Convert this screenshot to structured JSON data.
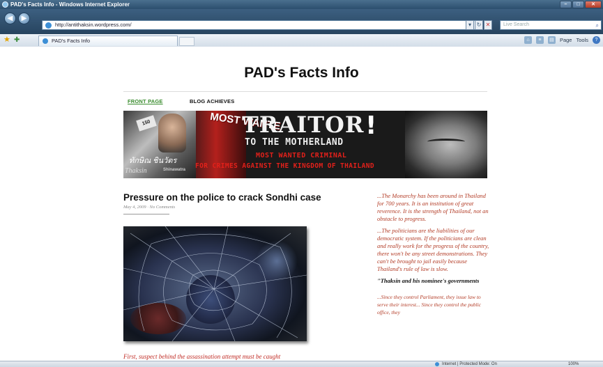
{
  "browser": {
    "window_title": "PAD's Facts Info - Windows Internet Explorer",
    "address": "http://antithaksin.wordpress.com/",
    "search_placeholder": "Live Search",
    "tab_title": "PAD's Facts Info",
    "command_bar": {
      "page": "Page",
      "tools": "Tools"
    },
    "status": {
      "zone": "Internet | Protected Mode: On",
      "zoom": "100%"
    }
  },
  "site": {
    "title": "PAD's Facts Info",
    "nav": {
      "front_page": "FRONT PAGE",
      "blog_archives": "BLOG ACHIEVES"
    }
  },
  "banner": {
    "traitor": "TRAITOR",
    "exclamation": "!",
    "to_the_motherland": "TO THE MOTHERLAND",
    "most_wanted_criminal": "MOST WANTED CRIMINAL",
    "for_crimes": "FOR CRIMES AGAINST THE KINGDOM OF THAILAND",
    "most_wanted_sign": "MOST WANTE",
    "thai_name": "ทักษิณ ชินวัตร",
    "latin_name": "Thaksin",
    "surname": "Shinawatra",
    "newspaper_tag": "150"
  },
  "post": {
    "title": "Pressure on the police to crack Sondhi case",
    "meta": "May 4, 2009 · No Comments",
    "excerpt": "First, suspect behind the assassination attempt must be caught"
  },
  "sidebar": {
    "p1": "...The Monarchy has been around in Thailand for 700 years. It is an institution of great reverence. It is the strength of Thailand, not an obstacle to progress.",
    "p2": "...The politicians are the liabilities of our democratic system. If the politicians are clean and really work for the progress of the country, there won't be any street demonstrations. They can't be brought to jail easily because Thailand's rule of law is slow.",
    "heading": "\"Thaksin and his nominee's governments",
    "p3": "...Since they control Parliament, they issue law to serve their interest... Since they control the public office, they"
  },
  "colors": {
    "nav_active": "#3a8c2e",
    "sidebar_text": "#b23a24",
    "banner_red": "#e2201a",
    "excerpt_red": "#c02b24"
  },
  "icons": [
    "ie-logo-icon",
    "back-arrow-icon",
    "forward-arrow-icon",
    "refresh-icon",
    "stop-icon",
    "search-icon",
    "favorites-star-icon",
    "add-favorites-icon",
    "home-icon",
    "feeds-icon",
    "print-icon",
    "help-icon",
    "globe-icon"
  ]
}
